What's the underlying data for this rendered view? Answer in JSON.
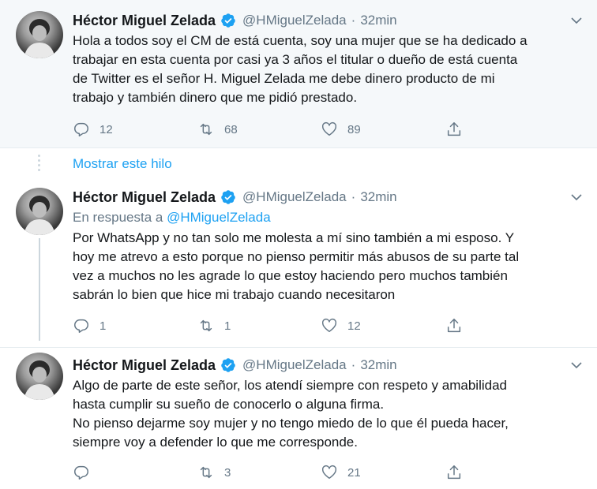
{
  "tweets": [
    {
      "author_name": "Héctor Miguel Zelada",
      "handle": "@HMiguelZelada",
      "separator": "·",
      "time": "32min",
      "text": "Hola a todos soy el CM de está cuenta, soy una mujer que se ha dedicado a\ntrabajar en esta cuenta por casi ya 3 años el titular o dueño de está cuenta\nde Twitter es el señor H. Miguel Zelada me debe dinero producto de mi\ntrabajo y también dinero que me pidió prestado.",
      "replies": "12",
      "retweets": "68",
      "likes": "89"
    },
    {
      "author_name": "Héctor Miguel Zelada",
      "handle": "@HMiguelZelada",
      "separator": "·",
      "time": "32min",
      "reply_prefix": "En respuesta a ",
      "reply_handle": "@HMiguelZelada",
      "text": "Por WhatsApp y no tan solo me molesta a mí sino también a mi esposo. Y\nhoy me atrevo a esto porque no pienso permitir más abusos de su parte tal\nvez a muchos no les agrade lo que estoy haciendo pero muchos también\nsabrán lo bien que hice mi trabajo cuando necesitaron",
      "replies": "1",
      "retweets": "1",
      "likes": "12"
    },
    {
      "author_name": "Héctor Miguel Zelada",
      "handle": "@HMiguelZelada",
      "separator": "·",
      "time": "32min",
      "text": "Algo de parte de este señor, los atendí siempre con respeto y amabilidad\nhasta cumplir su sueño de conocerlo o alguna firma.\nNo pienso dejarme soy mujer y no tengo miedo de lo que él pueda hacer,\nsiempre voy a defender lo que me corresponde.",
      "replies": "",
      "retweets": "3",
      "likes": "21"
    }
  ],
  "show_thread_label": "Mostrar este hilo",
  "colors": {
    "accent": "#1da1f2",
    "muted": "#657786",
    "text": "#14171a",
    "highlight_bg": "#f5f8fa"
  },
  "icons": [
    "verified-badge-icon",
    "chevron-down-icon",
    "reply-icon",
    "retweet-icon",
    "like-icon",
    "share-icon"
  ]
}
